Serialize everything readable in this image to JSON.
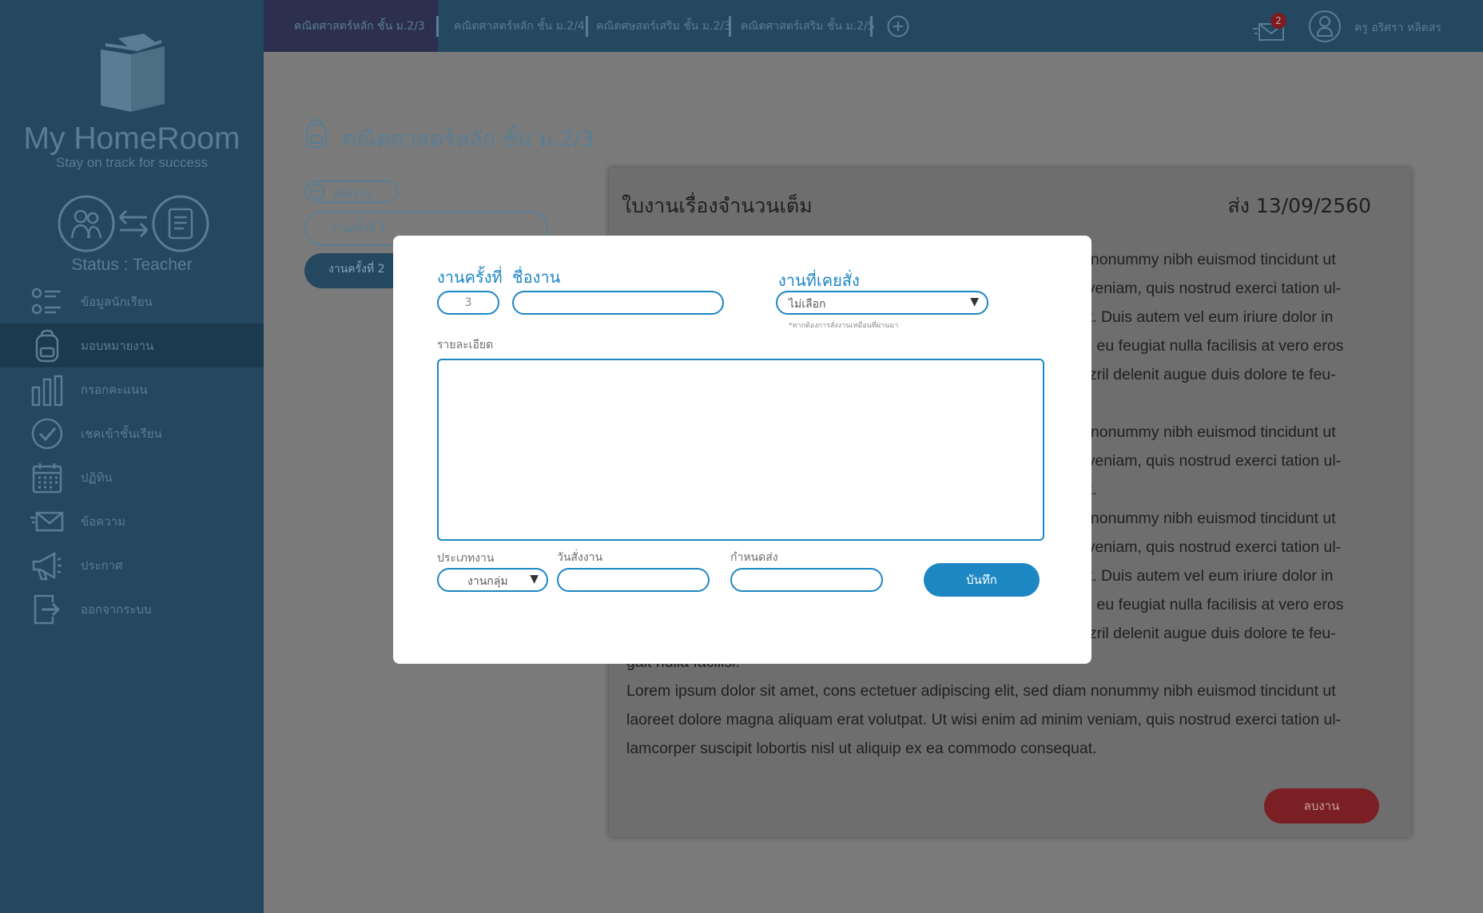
{
  "brand": {
    "title": "My HomeRoom",
    "tagline": "Stay on track for success",
    "status": "Status : Teacher"
  },
  "nav": {
    "items": [
      {
        "label": "ข้อมูลนักเรียน",
        "icon": "student-list-icon"
      },
      {
        "label": "มอบหมายงาน",
        "icon": "backpack-icon",
        "active": true
      },
      {
        "label": "กรอกคะแนน",
        "icon": "bar-chart-icon"
      },
      {
        "label": "เชคเข้าชั้นเรียน",
        "icon": "check-circle-icon"
      },
      {
        "label": "ปฏิทิน",
        "icon": "calendar-icon"
      },
      {
        "label": "ข้อความ",
        "icon": "mail-icon"
      },
      {
        "label": "ประกาศ",
        "icon": "megaphone-icon"
      },
      {
        "label": "ออกจากระบบ",
        "icon": "logout-icon"
      }
    ]
  },
  "tabs": [
    {
      "label": "คณิตศาสตร์หลัก ชั้น ม.2/3",
      "active": true
    },
    {
      "label": "คณิตศาสตร์หลัก ชั้น ม.2/4"
    },
    {
      "label": "คณิตศษสตร์เสริม ชั้น ม.2/3"
    },
    {
      "label": "คณิตศาสตร์เสริม ชั้น ม.2/5"
    }
  ],
  "header": {
    "mail_count": "2",
    "user_name": "ครู อริศรา หลิตสร"
  },
  "page": {
    "title": "คณิตศาสตร์หลัก ชั้น ม.2/3",
    "add_work_label": "เพิ่มงาน",
    "work_items": [
      "งานครั้งที่ 1",
      "งานครั้งที่ 2"
    ]
  },
  "document": {
    "title": "ใบงานเรื่องจำนวนเต็ม",
    "due": "ส่ง 13/09/2560",
    "lines": [
      "Lorem ipsum dolor sit amet, cons ectetuer adipiscing elit, sed diam nonummy nibh euismod tincidunt ut",
      "laoreet dolore magna aliquam erat volutpat. Ut wisi enim ad minim veniam, quis nostrud exerci tation ul-",
      "lamcorper suscipit lobortis nisl ut aliquip ex ea commodo consequat. Duis autem vel eum iriure dolor in",
      "hendrerit in vulputate velit esse molestie consequat, vel illum dolore eu feugiat nulla facilisis at vero eros",
      "et accumsan et iusto odio dignissim qui blandit praesent luptatum zzril delenit augue duis dolore te feu-",
      "gait nulla facilisi.",
      "Lorem ipsum dolor sit amet, cons ectetuer adipiscing elit, sed diam nonummy nibh euismod tincidunt ut",
      "laoreet dolore magna aliquam erat volutpat. Ut wisi enim ad minim veniam, quis nostrud exerci tation ul-",
      "lamcorper suscipit lobortis nisl ut aliquip ex ea commodo consequat.",
      "Lorem ipsum dolor sit amet, cons ectetuer adipiscing elit, sed diam nonummy nibh euismod tincidunt ut",
      "laoreet dolore magna aliquam erat volutpat. Ut wisi enim ad minim veniam, quis nostrud exerci tation ul-",
      "lamcorper suscipit lobortis nisl ut aliquip ex ea commodo consequat. Duis autem vel eum iriure dolor in",
      "hendrerit in vulputate velit esse molestie consequat, vel illum dolore eu feugiat nulla facilisis at vero eros",
      "et accumsan et iusto odio dignissim qui blandit praesent luptatum zzril delenit augue duis dolore te feu-",
      "gait nulla facilisi.",
      "Lorem ipsum dolor sit amet, cons ectetuer adipiscing elit, sed diam nonummy nibh euismod tincidunt ut",
      "laoreet dolore magna aliquam erat volutpat. Ut wisi enim ad minim veniam, quis nostrud exerci tation ul-",
      "lamcorper suscipit lobortis nisl ut aliquip ex ea commodo consequat."
    ],
    "delete_label": "ลบงาน"
  },
  "modal": {
    "work_no_label": "งานครั้งที่",
    "work_no_value": "3",
    "work_name_label": "ชื่องาน",
    "work_name_value": "",
    "previous_label": "งานที่เคยสั่ง",
    "previous_value": "ไม่เลือก",
    "previous_hint": "*หากต้องการสั่งงานเหมือนที่ผ่านมา",
    "detail_label": "รายละเอียด",
    "type_label": "ประเภทงาน",
    "type_value": "งานกลุ่ม",
    "assign_date_label": "วันสั่งงาน",
    "due_date_label": "กำหนดส่ง",
    "save_label": "บันทึก"
  },
  "colors": {
    "sidebar": "#244860",
    "accent": "#1d87c4",
    "danger": "#7a1f24",
    "overlay": "#7a7a7a"
  }
}
